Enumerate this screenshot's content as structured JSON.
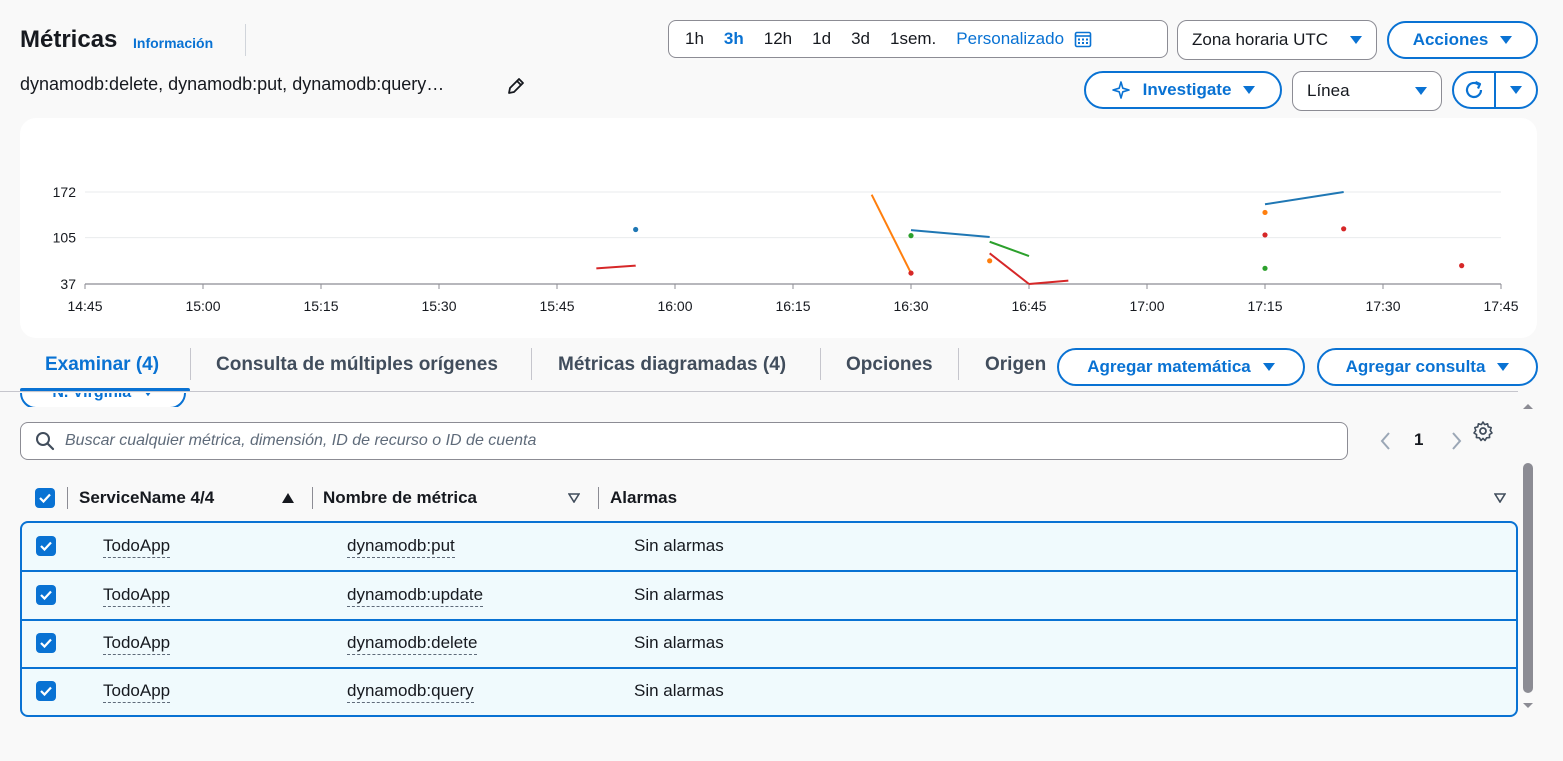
{
  "header": {
    "title": "Métricas",
    "info_link": "Información",
    "subtitle": "dynamodb:delete, dynamodb:put, dynamodb:query…",
    "edit_icon": "pencil-icon"
  },
  "time_range": {
    "options": [
      "1h",
      "3h",
      "12h",
      "1d",
      "3d",
      "1sem."
    ],
    "selected": "3h",
    "custom_label": "Personalizado",
    "calendar_icon": "calendar-icon"
  },
  "timezone": {
    "label": "Zona horaria UTC"
  },
  "actions": {
    "label": "Acciones"
  },
  "investigate": {
    "label": "Investigate",
    "icon": "sparkle-icon"
  },
  "chart_type": {
    "label": "Línea"
  },
  "refresh": {
    "icon": "refresh-icon"
  },
  "colors": {
    "accent": "#0972d3",
    "blue": "#1f77b4",
    "orange": "#ff7f0e",
    "green": "#2ca02c",
    "red": "#d62728"
  },
  "chart_data": {
    "type": "line",
    "x_ticks": [
      "14:45",
      "15:00",
      "15:15",
      "15:30",
      "15:45",
      "16:00",
      "16:15",
      "16:30",
      "16:45",
      "17:00",
      "17:15",
      "17:30",
      "17:45"
    ],
    "y_ticks": [
      172,
      105,
      37
    ],
    "ylim": [
      37,
      172
    ],
    "xlim": [
      "14:45",
      "17:45"
    ],
    "grid": true,
    "series": [
      {
        "color": "#1f77b4",
        "points": [
          [
            "15:55",
            117
          ],
          [
            "16:30",
            116
          ],
          [
            "16:40",
            106
          ],
          [
            "17:15",
            154
          ],
          [
            "17:25",
            172
          ]
        ]
      },
      {
        "color": "#ff7f0e",
        "points": [
          [
            "16:25",
            168
          ],
          [
            "16:30",
            53
          ],
          [
            "16:40",
            71
          ],
          [
            "17:15",
            142
          ]
        ]
      },
      {
        "color": "#2ca02c",
        "points": [
          [
            "16:30",
            108
          ],
          [
            "16:40",
            99
          ],
          [
            "16:45",
            78
          ],
          [
            "17:15",
            60
          ]
        ]
      },
      {
        "color": "#d62728",
        "points": [
          [
            "15:50",
            60
          ],
          [
            "15:55",
            64
          ],
          [
            "16:30",
            53
          ],
          [
            "16:40",
            82
          ],
          [
            "16:45",
            37
          ],
          [
            "16:50",
            42
          ],
          [
            "17:15",
            109
          ],
          [
            "17:25",
            118
          ],
          [
            "17:40",
            64
          ]
        ]
      }
    ],
    "segments": [
      {
        "color": "#d62728",
        "from": [
          "15:50",
          60
        ],
        "to": [
          "15:55",
          64
        ]
      },
      {
        "color": "#ff7f0e",
        "from": [
          "16:25",
          168
        ],
        "to": [
          "16:30",
          53
        ]
      },
      {
        "color": "#1f77b4",
        "from": [
          "16:30",
          116
        ],
        "to": [
          "16:40",
          106
        ]
      },
      {
        "color": "#2ca02c",
        "from": [
          "16:40",
          99
        ],
        "to": [
          "16:45",
          78
        ]
      },
      {
        "color": "#d62728",
        "from": [
          "16:40",
          82
        ],
        "to": [
          "16:45",
          37
        ]
      },
      {
        "color": "#d62728",
        "from": [
          "16:45",
          37
        ],
        "to": [
          "16:50",
          42
        ]
      },
      {
        "color": "#1f77b4",
        "from": [
          "17:15",
          154
        ],
        "to": [
          "17:25",
          172
        ]
      }
    ],
    "dots": [
      {
        "color": "#1f77b4",
        "at": [
          "15:55",
          117
        ]
      },
      {
        "color": "#2ca02c",
        "at": [
          "16:30",
          108
        ]
      },
      {
        "color": "#d62728",
        "at": [
          "16:30",
          53
        ]
      },
      {
        "color": "#ff7f0e",
        "at": [
          "16:40",
          71
        ]
      },
      {
        "color": "#ff7f0e",
        "at": [
          "17:15",
          142
        ]
      },
      {
        "color": "#d62728",
        "at": [
          "17:15",
          109
        ]
      },
      {
        "color": "#2ca02c",
        "at": [
          "17:15",
          60
        ]
      },
      {
        "color": "#d62728",
        "at": [
          "17:25",
          118
        ]
      },
      {
        "color": "#d62728",
        "at": [
          "17:40",
          64
        ]
      }
    ]
  },
  "tabs": {
    "items": [
      "Examinar (4)",
      "Consulta de múltiples orígenes",
      "Métricas diagramadas (4)",
      "Opciones",
      "Origen"
    ],
    "active": "Examinar (4)"
  },
  "add_math": {
    "label": "Agregar matemática"
  },
  "add_query": {
    "label": "Agregar consulta"
  },
  "region": {
    "label": "N. Virginia"
  },
  "search": {
    "placeholder": "Buscar cualquier métrica, dimensión, ID de recurso o ID de cuenta"
  },
  "pager": {
    "page": "1"
  },
  "table": {
    "columns": [
      "ServiceName 4/4",
      "Nombre de métrica",
      "Alarmas"
    ],
    "rows": [
      {
        "service": "TodoApp",
        "metric": "dynamodb:put",
        "alarms": "Sin alarmas"
      },
      {
        "service": "TodoApp",
        "metric": "dynamodb:update",
        "alarms": "Sin alarmas"
      },
      {
        "service": "TodoApp",
        "metric": "dynamodb:delete",
        "alarms": "Sin alarmas"
      },
      {
        "service": "TodoApp",
        "metric": "dynamodb:query",
        "alarms": "Sin alarmas"
      }
    ]
  }
}
